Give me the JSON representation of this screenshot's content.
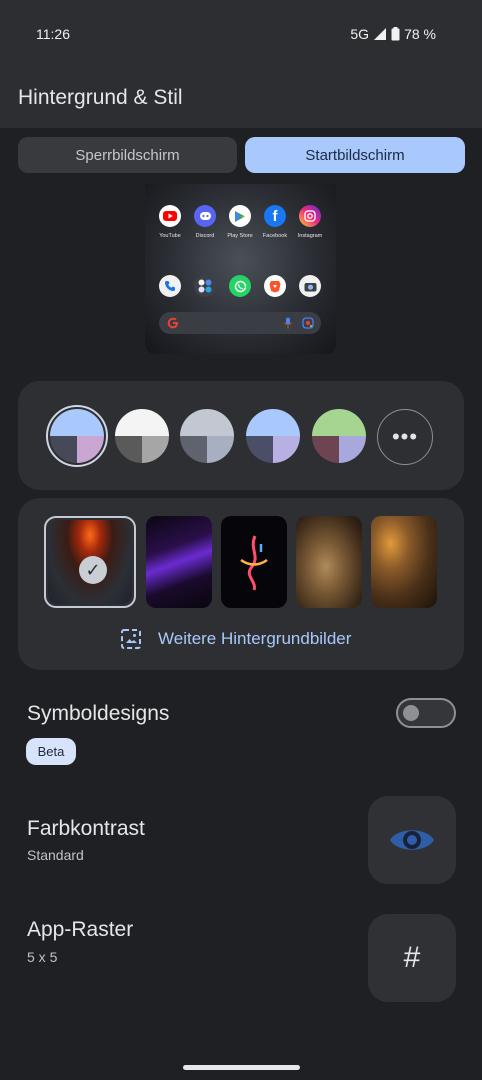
{
  "status": {
    "time": "11:26",
    "network": "5G",
    "battery": "78 %"
  },
  "header": {
    "title": "Hintergrund & Stil"
  },
  "tabs": [
    {
      "label": "Sperrbildschirm",
      "selected": false
    },
    {
      "label": "Startbildschirm",
      "selected": true
    }
  ],
  "preview": {
    "apps_row1": [
      "YouTube",
      "Discord",
      "Play Store",
      "Facebook",
      "Instagram"
    ]
  },
  "color_options": {
    "selected_index": 0,
    "swatches": [
      {
        "top": "#a9c8fb",
        "bottom_left": "#464a58",
        "bottom_right": "#c9a7d2"
      },
      {
        "top": "#f4f4f4",
        "bottom_left": "#5a5a5a",
        "bottom_right": "#a6a6a6"
      },
      {
        "top": "#c3c7d1",
        "bottom_left": "#5f636d",
        "bottom_right": "#a7afc0"
      },
      {
        "top": "#a9c8fb",
        "bottom_left": "#4a4e66",
        "bottom_right": "#b8b0e2"
      },
      {
        "top": "#a5d591",
        "bottom_left": "#6d4452",
        "bottom_right": "#a9a8dc"
      }
    ],
    "more_icon": "more-horizontal-icon"
  },
  "wallpapers": {
    "selected_index": 0,
    "more_label": "Weitere Hintergrundbilder",
    "more_icon": "image-icon"
  },
  "settings": {
    "icon_designs": {
      "title": "Symboldesigns",
      "badge": "Beta",
      "enabled": false
    },
    "color_contrast": {
      "title": "Farbkontrast",
      "value": "Standard",
      "icon": "eye-icon"
    },
    "app_grid": {
      "title": "App-Raster",
      "value": "5 x 5",
      "icon": "grid-icon"
    }
  },
  "colors": {
    "accent": "#a9c8fb",
    "surface": "#2e2f33",
    "background": "#1f2023"
  }
}
